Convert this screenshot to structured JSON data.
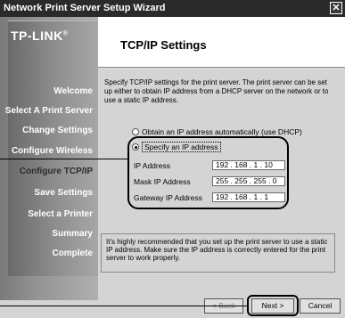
{
  "window": {
    "title": "Network Print Server Setup Wizard",
    "close_label": "✕"
  },
  "sidebar": {
    "logo": "TP-LINK",
    "logo_mark": "®",
    "items": [
      {
        "label": "Welcome"
      },
      {
        "label": "Select A Print Server"
      },
      {
        "label": "Change Settings"
      },
      {
        "label": "Configure Wireless"
      },
      {
        "label": "Configure TCP/IP"
      },
      {
        "label": "Save Settings"
      },
      {
        "label": "Select a Printer"
      },
      {
        "label": "Summary"
      },
      {
        "label": "Complete"
      }
    ]
  },
  "page": {
    "title": "TCP/IP Settings",
    "intro": "Specify TCP/IP settings for the print server. The print server can be set up either to obtain IP address from a DHCP server on the network or to use a static IP address."
  },
  "options": {
    "dhcp_label": "Obtain an IP address automatically (use DHCP)",
    "static_label": "Specify an IP address",
    "selected": "static"
  },
  "fields": {
    "ip": {
      "label": "IP Address",
      "value": "192 . 168 .  1  . 10"
    },
    "mask": {
      "label": "Mask IP Address",
      "value": "255 . 255 . 255 .  0"
    },
    "gateway": {
      "label": "Gateway IP Address",
      "value": "192 . 168 .  1  .  1"
    }
  },
  "note": "It's highly recommended that you set up the print server to use a static IP address. Make sure the IP address is correctly entered for the print server to work properly.",
  "buttons": {
    "back": "< Back",
    "next": "Next >",
    "cancel": "Cancel"
  }
}
